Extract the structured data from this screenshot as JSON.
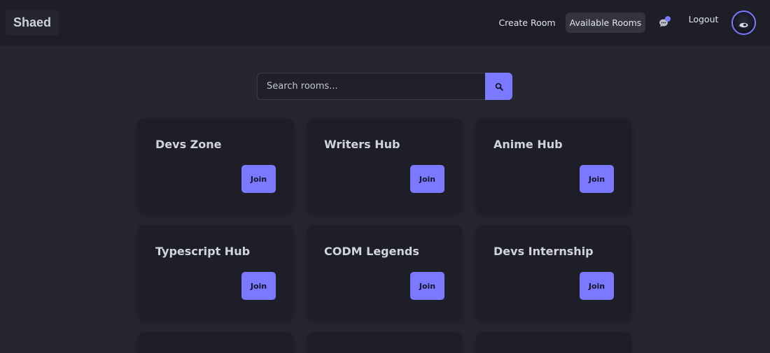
{
  "app": {
    "brand": "Shaed"
  },
  "nav": {
    "create_room": "Create Room",
    "available_rooms": "Available Rooms",
    "logout": "Logout",
    "chat_icon": "chat-bubble-icon",
    "notification_dot_color": "#7b79ff"
  },
  "search": {
    "placeholder": "Search rooms...",
    "value": "",
    "icon": "search-icon"
  },
  "colors": {
    "accent": "#7b79ff",
    "background": "#252630",
    "card": "#1d1e27"
  },
  "rooms": [
    {
      "name": "Devs Zone",
      "action": "Join"
    },
    {
      "name": "Writers Hub",
      "action": "Join"
    },
    {
      "name": "Anime Hub",
      "action": "Join"
    },
    {
      "name": "Typescript Hub",
      "action": "Join"
    },
    {
      "name": "CODM Legends",
      "action": "Join"
    },
    {
      "name": "Devs Internship",
      "action": "Join"
    }
  ]
}
